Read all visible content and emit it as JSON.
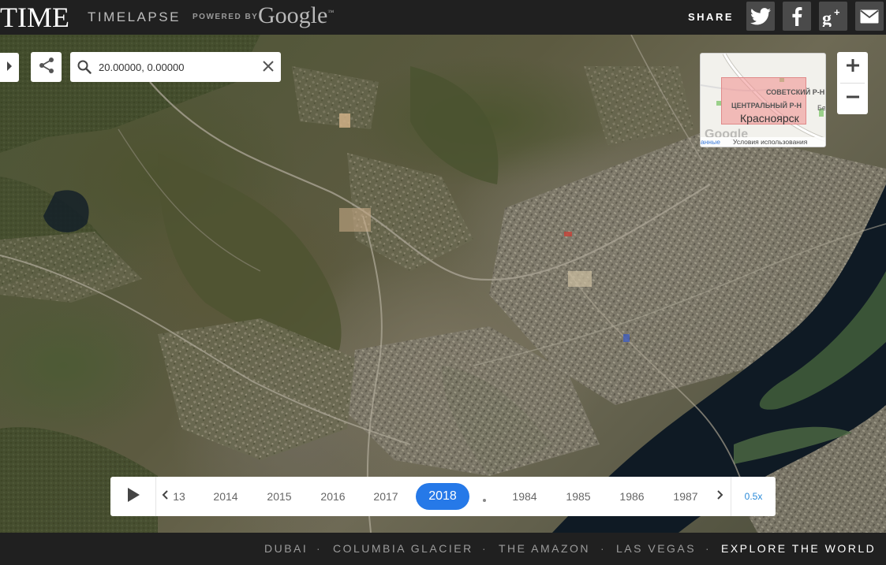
{
  "header": {
    "brand": "TIME",
    "product": "TIMELAPSE",
    "powered_by": "POWERED BY",
    "google": "Google",
    "tm": "™",
    "share_label": "SHARE",
    "share_buttons": [
      {
        "icon": "twitter-icon"
      },
      {
        "icon": "facebook-icon"
      },
      {
        "icon": "google-plus-icon"
      },
      {
        "icon": "email-icon"
      }
    ]
  },
  "search": {
    "value": "20.00000, 0.00000",
    "placeholder": ""
  },
  "minimap": {
    "labels": {
      "sovetsky": "СОВЕТСКИЙ Р-Н",
      "central": "ЦЕНТРАЛЬНЫЙ Р-Н",
      "partial": "Бе",
      "city": "Красноярск"
    },
    "logo": "Google",
    "data_link": "анные",
    "terms": "Условия использования"
  },
  "zoom": {
    "in": "+",
    "out": "−"
  },
  "timeline": {
    "partial_year": "13",
    "years_before": [
      "2014",
      "2015",
      "2016",
      "2017"
    ],
    "active_year": "2018",
    "years_after": [
      "1984",
      "1985",
      "1986",
      "1987"
    ],
    "speed": "0.5x"
  },
  "footer": {
    "links": [
      "DUBAI",
      "COLUMBIA GLACIER",
      "THE AMAZON",
      "LAS VEGAS"
    ],
    "explore": "EXPLORE THE WORLD",
    "separator": "·"
  },
  "colors": {
    "accent": "#2679e8",
    "bar_bg": "#202020",
    "share_btn": "#4a4a4a",
    "river": "#0f1a24"
  }
}
